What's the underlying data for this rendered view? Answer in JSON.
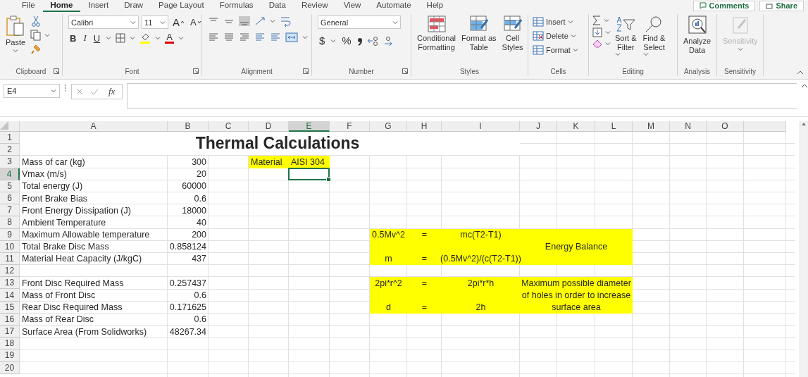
{
  "tabs": [
    {
      "label": "File",
      "selected": false
    },
    {
      "label": "Home",
      "selected": true
    },
    {
      "label": "Insert",
      "selected": false
    },
    {
      "label": "Draw",
      "selected": false
    },
    {
      "label": "Page Layout",
      "selected": false
    },
    {
      "label": "Formulas",
      "selected": false
    },
    {
      "label": "Data",
      "selected": false
    },
    {
      "label": "Review",
      "selected": false
    },
    {
      "label": "View",
      "selected": false
    },
    {
      "label": "Automate",
      "selected": false
    },
    {
      "label": "Help",
      "selected": false
    }
  ],
  "header_buttons": [
    {
      "label": "Comments",
      "kind": "comments"
    },
    {
      "label": "Share",
      "kind": "share"
    }
  ],
  "ribbon": {
    "clipboard": {
      "paste": "Paste",
      "label": "Clipboard"
    },
    "font": {
      "name": "Calibri",
      "size": "11",
      "grow": "A",
      "shrink": "A",
      "bold": "B",
      "italic": "I",
      "underline": "U",
      "color_button": "A",
      "label": "Font"
    },
    "alignment": {
      "label": "Alignment"
    },
    "number": {
      "format": "General",
      "currency": "$",
      "percent": "%",
      "label": "Number"
    },
    "styles": {
      "buttons": [
        [
          "Conditional",
          "Formatting"
        ],
        [
          "Format as",
          "Table"
        ],
        [
          "Cell",
          "Styles"
        ]
      ],
      "label": "Styles"
    },
    "cells": {
      "buttons": [
        "Insert",
        "Delete",
        "Format"
      ],
      "label": "Cells"
    },
    "editing": {
      "buttons": [
        [
          "Sort &",
          "Filter"
        ],
        [
          "Find &",
          "Select"
        ]
      ],
      "label": "Editing"
    },
    "analysis": {
      "button": [
        "Analyze",
        "Data"
      ],
      "label": "Analysis"
    },
    "sensitivity": {
      "button": "Sensitivity",
      "disabled": true,
      "label": "Sensitivity"
    }
  },
  "formula_bar": {
    "name_box": "E4",
    "function_label": "fx"
  },
  "sheet": {
    "columns": [
      {
        "label": "A",
        "selected": false
      },
      {
        "label": "B",
        "selected": false
      },
      {
        "label": "C",
        "selected": false
      },
      {
        "label": "D",
        "selected": false
      },
      {
        "label": "E",
        "selected": true
      },
      {
        "label": "F",
        "selected": false
      },
      {
        "label": "G",
        "selected": false
      },
      {
        "label": "H",
        "selected": false
      },
      {
        "label": "I",
        "selected": false
      },
      {
        "label": "J",
        "selected": false
      },
      {
        "label": "K",
        "selected": false
      },
      {
        "label": "L",
        "selected": false
      },
      {
        "label": "M",
        "selected": false
      },
      {
        "label": "N",
        "selected": false
      },
      {
        "label": "O",
        "selected": false
      }
    ],
    "title": "Thermal Calculations",
    "rows": [
      {
        "number": "1",
        "selected": false
      },
      {
        "number": "2",
        "selected": false
      },
      {
        "number": "3",
        "selected": false,
        "label": "Mass of car (kg)",
        "value": "300"
      },
      {
        "number": "4",
        "selected": true,
        "label": "Vmax (m/s)",
        "value": "20"
      },
      {
        "number": "5",
        "selected": false,
        "label": "Total energy (J)",
        "value": "60000"
      },
      {
        "number": "6",
        "selected": false,
        "label": "Front Brake Bias",
        "value": "0.6"
      },
      {
        "number": "7",
        "selected": false,
        "label": "Front Energy Dissipation (J)",
        "value": "18000"
      },
      {
        "number": "8",
        "selected": false,
        "label": "Ambient Temperature",
        "value": "40"
      },
      {
        "number": "9",
        "selected": false,
        "label": "Maximum Allowable temperature",
        "value": "200"
      },
      {
        "number": "10",
        "selected": false,
        "label": "Total Brake Disc Mass",
        "value": "0.858124"
      },
      {
        "number": "11",
        "selected": false,
        "label": "Material Heat Capacity (J/kgC)",
        "value": "437"
      },
      {
        "number": "12",
        "selected": false
      },
      {
        "number": "13",
        "selected": false,
        "label": "Front Disc Required Mass",
        "value": "0.257437"
      },
      {
        "number": "14",
        "selected": false,
        "label": "Mass of Front Disc",
        "value": "0.6"
      },
      {
        "number": "15",
        "selected": false,
        "label": "Rear Disc Required Mass",
        "value": "0.171625"
      },
      {
        "number": "16",
        "selected": false,
        "label": "Mass of Rear Disc",
        "value": "0.6"
      },
      {
        "number": "17",
        "selected": false,
        "label": "Surface Area (From Solidworks)",
        "value": "48267.34"
      },
      {
        "number": "18",
        "selected": false
      },
      {
        "number": "19",
        "selected": false
      },
      {
        "number": "20",
        "selected": false
      }
    ],
    "material": {
      "label": "Material",
      "value": "AISI 304"
    },
    "equations": [
      {
        "lines": [
          {
            "lhs": "0.5Mv^2",
            "op": "=",
            "rhs": "mc(T2-T1)"
          },
          {
            "lhs": "m",
            "op": "=",
            "rhs": "(0.5Mv^2)/(c(T2-T1))"
          }
        ],
        "note": "Energy Balance"
      },
      {
        "lines": [
          {
            "lhs": "2pi*r^2",
            "op": "=",
            "rhs": "2pi*r*h"
          },
          {
            "lhs": "d",
            "op": "=",
            "rhs": "2h"
          }
        ],
        "note": "Maximum possible diameter of holes in order to increase surface area"
      }
    ]
  }
}
